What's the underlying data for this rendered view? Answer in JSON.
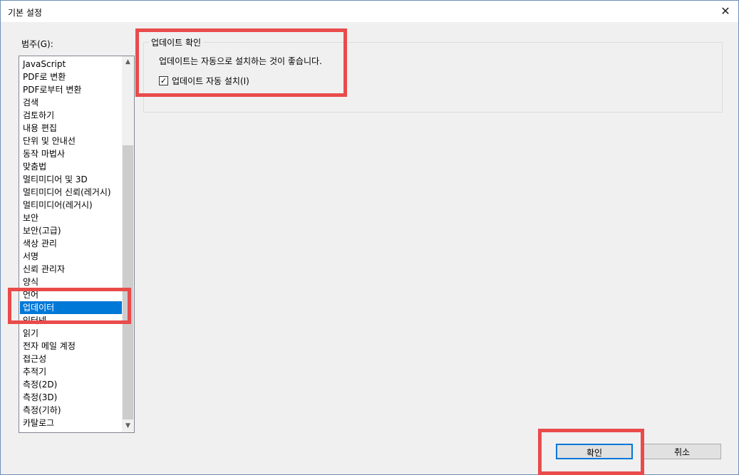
{
  "window": {
    "title": "기본 설정",
    "close_glyph": "✕"
  },
  "categories": {
    "label": "범주(G):",
    "items": [
      "JavaScript",
      "PDF로 변환",
      "PDF로부터 변환",
      "검색",
      "검토하기",
      "내용 편집",
      "단위 및 안내선",
      "동작 마법사",
      "맞춤법",
      "멀티미디어 및 3D",
      "멀티미디어 신뢰(레거시)",
      "멀티미디어(레거시)",
      "보안",
      "보안(고급)",
      "색상 관리",
      "서명",
      "신뢰 관리자",
      "양식",
      "언어",
      "업데이터",
      "인터넷",
      "읽기",
      "전자 메일 계정",
      "접근성",
      "추적기",
      "측정(2D)",
      "측정(3D)",
      "측정(기하)",
      "카탈로그"
    ],
    "selected": "업데이터"
  },
  "update_group": {
    "title": "업데이트 확인",
    "description": "업데이트는 자동으로 설치하는 것이 좋습니다.",
    "checkbox_label": "업데이트 자동 설치(I)",
    "checkbox_checked": true,
    "check_glyph": "✓"
  },
  "buttons": {
    "ok": "확인",
    "cancel": "취소"
  },
  "colors": {
    "selection": "#0078d7",
    "highlight": "#e94b4b"
  }
}
